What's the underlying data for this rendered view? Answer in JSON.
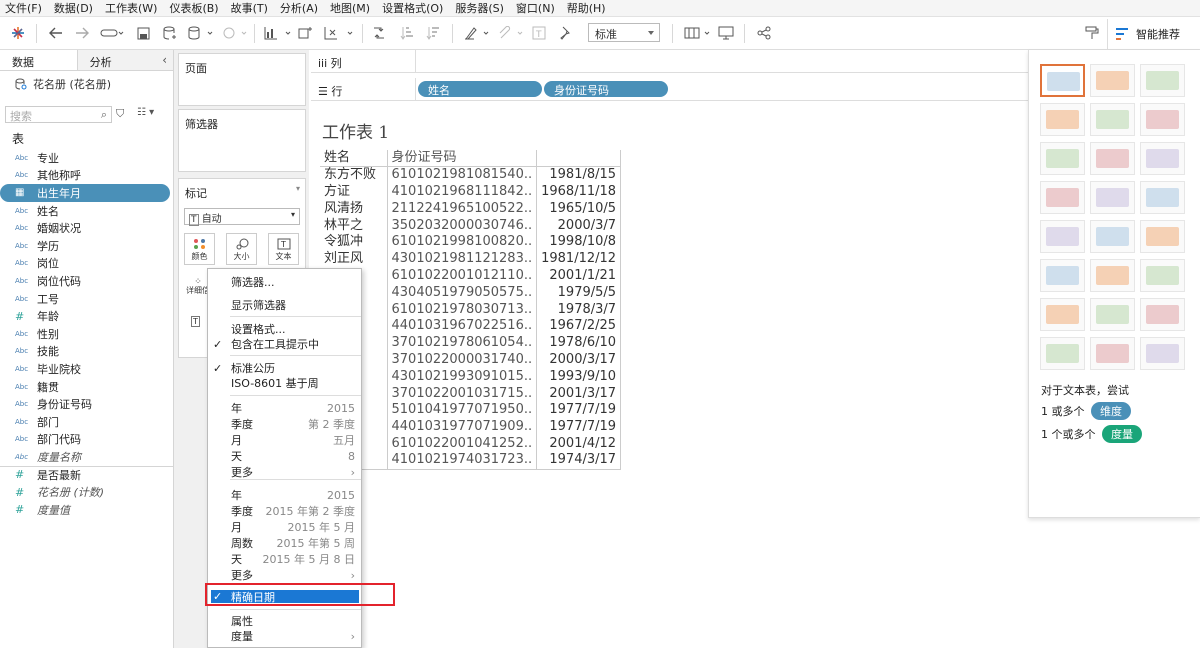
{
  "menu": [
    "文件(F)",
    "数据(D)",
    "工作表(W)",
    "仪表板(B)",
    "故事(T)",
    "分析(A)",
    "地图(M)",
    "设置格式(O)",
    "服务器(S)",
    "窗口(N)",
    "帮助(H)"
  ],
  "toolbar": {
    "fit": "标准",
    "show_me": "智能推荐"
  },
  "left": {
    "tabs": [
      "数据",
      "分析"
    ],
    "datasource": "花名册 (花名册)",
    "search_placeholder": "搜索",
    "section_title": "表",
    "fields": [
      {
        "type": "Abc",
        "name": "专业"
      },
      {
        "type": "Abc",
        "name": "其他称呼"
      },
      {
        "type": "date",
        "name": "出生年月",
        "selected": true
      },
      {
        "type": "Abc",
        "name": "姓名"
      },
      {
        "type": "Abc",
        "name": "婚姻状况"
      },
      {
        "type": "Abc",
        "name": "学历"
      },
      {
        "type": "Abc",
        "name": "岗位"
      },
      {
        "type": "Abc",
        "name": "岗位代码"
      },
      {
        "type": "Abc",
        "name": "工号"
      },
      {
        "type": "#",
        "name": "年龄"
      },
      {
        "type": "Abc",
        "name": "性别"
      },
      {
        "type": "Abc",
        "name": "技能"
      },
      {
        "type": "Abc",
        "name": "毕业院校"
      },
      {
        "type": "Abc",
        "name": "籍贯"
      },
      {
        "type": "Abc",
        "name": "身份证号码"
      },
      {
        "type": "Abc",
        "name": "部门"
      },
      {
        "type": "Abc",
        "name": "部门代码"
      },
      {
        "type": "Abc",
        "name": "度量名称",
        "italic": true
      },
      {
        "type": "#",
        "name": "是否最新",
        "sep": true
      },
      {
        "type": "#",
        "name": "花名册 (计数)",
        "italic": true
      },
      {
        "type": "#",
        "name": "度量值",
        "italic": true
      }
    ]
  },
  "cards": {
    "pages": "页面",
    "filters": "筛选器",
    "marks": "标记",
    "marks_type": "自动",
    "color": "颜色",
    "size": "大小",
    "text": "文本",
    "detail": "详细信"
  },
  "shelves": {
    "columns": "列",
    "rows": "行",
    "row_pills": [
      "姓名",
      "身份证号码"
    ]
  },
  "sheet": {
    "title": "工作表 1",
    "headers": [
      "姓名",
      "身份证号码",
      ""
    ],
    "rows": [
      [
        "东方不败",
        "6101021981081540..",
        "1981/8/15"
      ],
      [
        "方证",
        "4101021968111842..",
        "1968/11/18"
      ],
      [
        "风清扬",
        "2112241965100522..",
        "1965/10/5"
      ],
      [
        "林平之",
        "3502032000030746..",
        "2000/3/7"
      ],
      [
        "令狐冲",
        "6101021998100820..",
        "1998/10/8"
      ],
      [
        "刘正风",
        "4301021981121283..",
        "1981/12/12"
      ],
      [
        "",
        "6101022001012110..",
        "2001/1/21"
      ],
      [
        "",
        "4304051979050575..",
        "1979/5/5"
      ],
      [
        "",
        "6101021978030713..",
        "1978/3/7"
      ],
      [
        "",
        "4401031967022516..",
        "1967/2/25"
      ],
      [
        "",
        "3701021978061054..",
        "1978/6/10"
      ],
      [
        "",
        "3701022000031740..",
        "2000/3/17"
      ],
      [
        "",
        "4301021993091015..",
        "1993/9/10"
      ],
      [
        "",
        "3701022001031715..",
        "2001/3/17"
      ],
      [
        "",
        "5101041977071950..",
        "1977/7/19"
      ],
      [
        "",
        "4401031977071909..",
        "1977/7/19"
      ],
      [
        "",
        "6101022001041252..",
        "2001/4/12"
      ],
      [
        "",
        "4101021974031723..",
        "1974/3/17"
      ]
    ]
  },
  "context_menu": {
    "filter": "筛选器...",
    "show_filter": "显示筛选器",
    "format": "设置格式...",
    "tooltip": "包含在工具提示中",
    "std_calendar": "标准公历",
    "iso": "ISO-8601 基于周",
    "g1": [
      [
        "年",
        "2015"
      ],
      [
        "季度",
        "第 2 季度"
      ],
      [
        "月",
        "五月"
      ],
      [
        "天",
        "8"
      ],
      [
        "更多",
        "›"
      ]
    ],
    "g2": [
      [
        "年",
        "2015"
      ],
      [
        "季度",
        "2015 年第 2 季度"
      ],
      [
        "月",
        "2015 年 5 月"
      ],
      [
        "周数",
        "2015 年第 5 周"
      ],
      [
        "天",
        "2015 年 5 月 8 日"
      ],
      [
        "更多",
        "›"
      ]
    ],
    "exact": "精确日期",
    "attribute": "属性",
    "measure": "度量"
  },
  "show_me": {
    "hint": "对于文本表，尝试",
    "dim_prefix": "1 或多个",
    "dim": "维度",
    "meas_prefix": "1 个或多个",
    "meas": "度量"
  },
  "colors": {
    "accent": "#4a90b8",
    "highlight": "#1b78d4",
    "red": "#e3232c",
    "measure_green": "#1aa579",
    "orange": "#e0733a"
  }
}
